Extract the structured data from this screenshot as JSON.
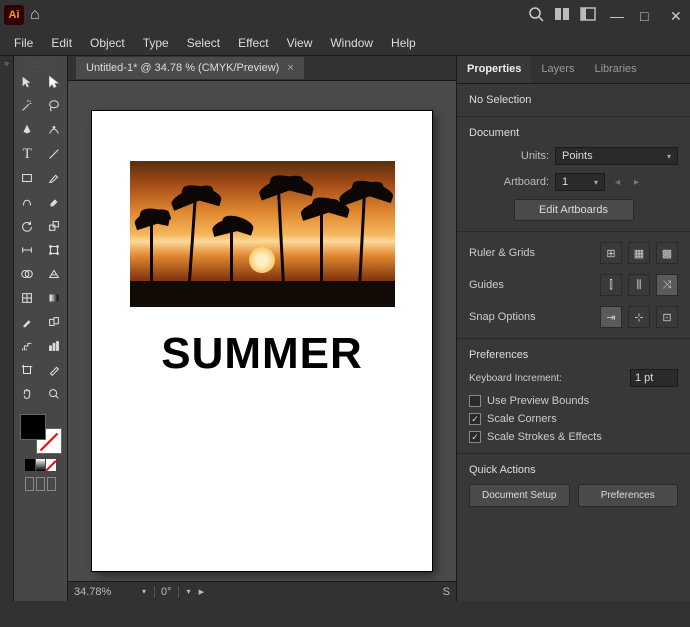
{
  "titlebar": {
    "logo": "Ai"
  },
  "menu": {
    "file": "File",
    "edit": "Edit",
    "object": "Object",
    "type": "Type",
    "select": "Select",
    "effect": "Effect",
    "view": "View",
    "window": "Window",
    "help": "Help"
  },
  "doc": {
    "tab": "Untitled-1* @ 34.78 % (CMYK/Preview)",
    "close": "×"
  },
  "canvas": {
    "text": "SUMMER"
  },
  "status": {
    "zoom": "34.78%",
    "rotate": "0°",
    "arrow": "▸",
    "s": "S"
  },
  "panels": {
    "tabs": {
      "properties": "Properties",
      "layers": "Layers",
      "libraries": "Libraries"
    },
    "selection": "No Selection",
    "document": {
      "title": "Document",
      "units_lbl": "Units:",
      "units_val": "Points",
      "artboard_lbl": "Artboard:",
      "artboard_val": "1",
      "edit_btn": "Edit Artboards"
    },
    "ruler": "Ruler & Grids",
    "guides": "Guides",
    "snap": "Snap Options",
    "prefs": {
      "title": "Preferences",
      "keyinc_lbl": "Keyboard Increment:",
      "keyinc_val": "1 pt",
      "preview": "Use Preview Bounds",
      "corners": "Scale Corners",
      "strokes": "Scale Strokes & Effects"
    },
    "quick": {
      "title": "Quick Actions",
      "docsetup": "Document Setup",
      "prefs": "Preferences"
    }
  }
}
